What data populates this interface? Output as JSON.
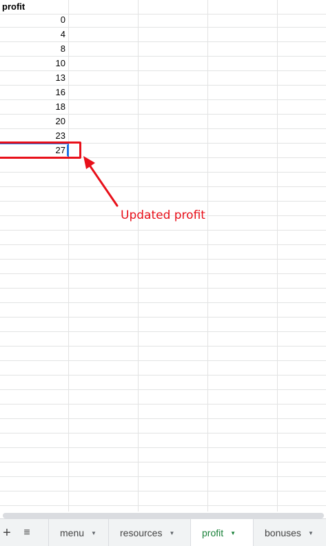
{
  "sheet": {
    "header": "profit",
    "values": [
      "0",
      "4",
      "8",
      "10",
      "13",
      "16",
      "18",
      "20",
      "23",
      "27"
    ],
    "selected_value": "27"
  },
  "annotation": {
    "text": "Updated profit",
    "color": "#e8101a"
  },
  "tabs": [
    {
      "label": "menu",
      "active": false
    },
    {
      "label": "resources",
      "active": false
    },
    {
      "label": "profit",
      "active": true
    },
    {
      "label": "bonuses",
      "active": false
    }
  ],
  "tabbar": {
    "add_icon": "plus-icon",
    "all_sheets_icon": "hamburger-list-icon"
  },
  "colors": {
    "selection": "#1a73e8",
    "active_tab_text": "#188038"
  }
}
